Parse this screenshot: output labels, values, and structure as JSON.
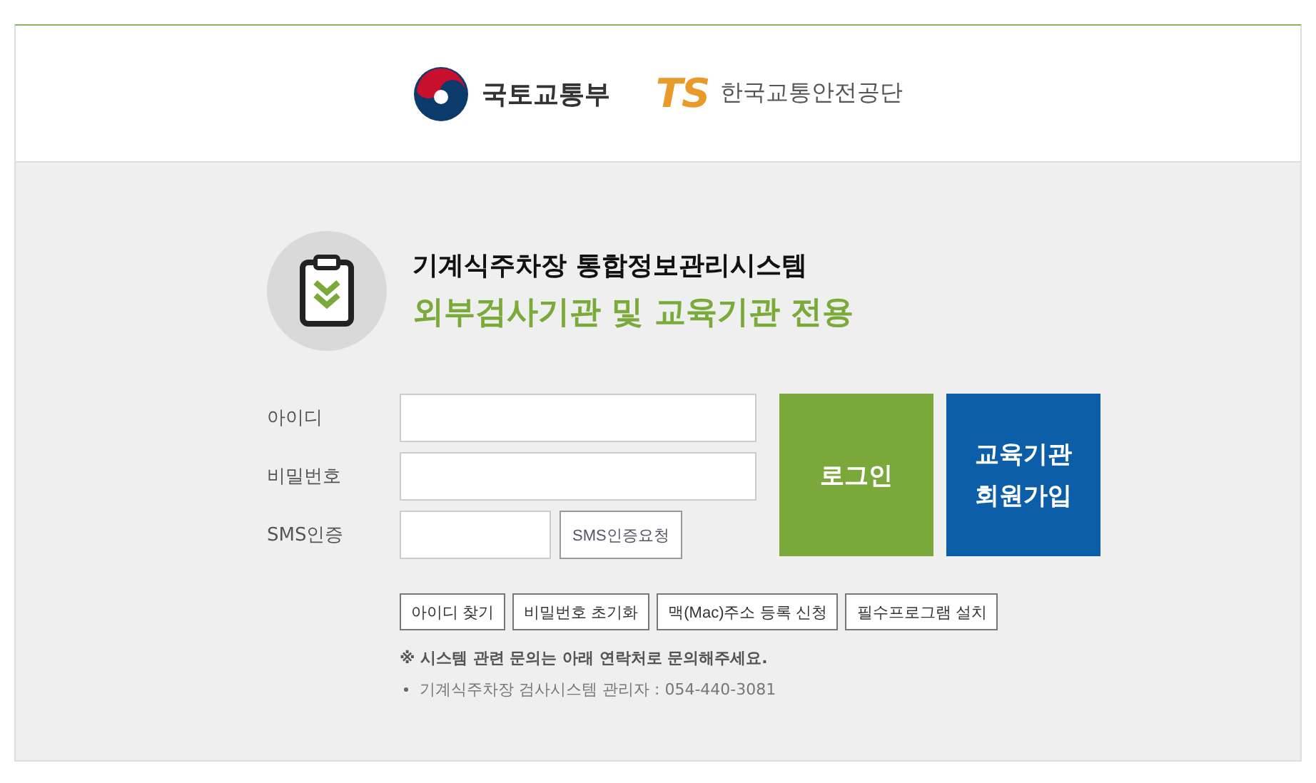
{
  "header": {
    "ministry_name": "국토교통부",
    "agency_mark": "TS",
    "agency_name": "한국교통안전공단"
  },
  "title": {
    "system_name": "기계식주차장 통합정보관리시스템",
    "subtitle": "외부검사기관 및 교육기관 전용"
  },
  "form": {
    "fields": [
      {
        "label": "아이디",
        "kind": "text"
      },
      {
        "label": "비밀번호",
        "kind": "password"
      },
      {
        "label": "SMS인증",
        "kind": "sms",
        "button": "SMS인증요청"
      }
    ],
    "login_button": "로그인",
    "signup_button": [
      "교육기관",
      "회원가입"
    ]
  },
  "links": [
    "아이디 찾기",
    "비밀번호 초기화",
    "맥(Mac)주소 등록 신청",
    "필수프로그램 설치"
  ],
  "notice": "※ 시스템 관련 문의는 아래 연락처로 문의해주세요.",
  "contacts": [
    "기계식주차장 검사시스템 관리자 : 054-440-3081"
  ]
}
